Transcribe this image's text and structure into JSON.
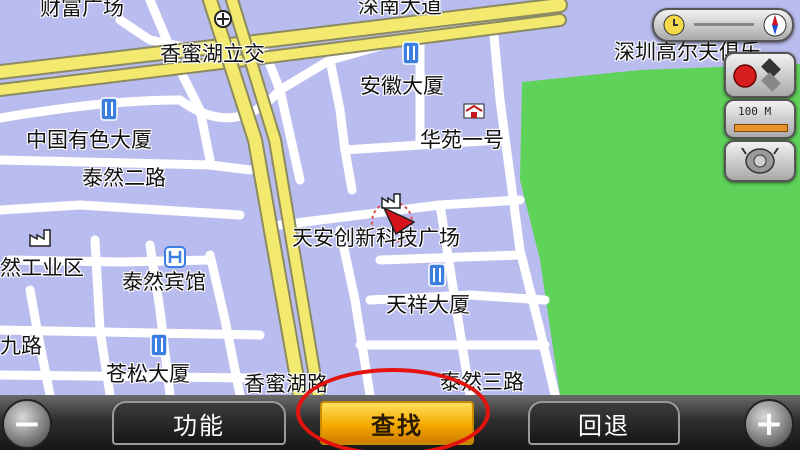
{
  "map": {
    "labels": {
      "top_left_partial": "财富广场",
      "top_center_partial": "深南大道",
      "top_right_partial": "深圳高尔夫俱乐",
      "interchange": "香蜜湖立交",
      "anhui": "安徽大厦",
      "nonferrous": "中国有色大厦",
      "huayuan": "华苑一号",
      "tairan2": "泰然二路",
      "tianan": "天安创新科技广场",
      "industrial_partial": "然工业区",
      "tairan_hotel": "泰然宾馆",
      "tianxiang": "天祥大厦",
      "jiu_road_partial": "九路",
      "cangsong": "苍松大厦",
      "xiangmihu_road_partial": "香蜜湖路",
      "tairan3": "泰然三路"
    },
    "poi_icons": [
      "building-icon",
      "hotel-icon",
      "factory-icon",
      "house-icon",
      "position-arrow-icon"
    ]
  },
  "widgets": {
    "scale_text": "100 M",
    "compass_icon": "compass-icon",
    "layer_icon": "layer-toggle-icon",
    "gps_icon": "gps-satellite-icon"
  },
  "toolbar": {
    "zoom_out": "−",
    "function_label": "功能",
    "search_label": "查找",
    "back_label": "回退",
    "zoom_in": "+"
  },
  "colors": {
    "map_bg": "#b9bcee",
    "road": "#ffffff",
    "main_road": "#f2e96e",
    "park": "#5fd25a",
    "search_button": "#f5a900",
    "highlight": "#e3120d"
  }
}
